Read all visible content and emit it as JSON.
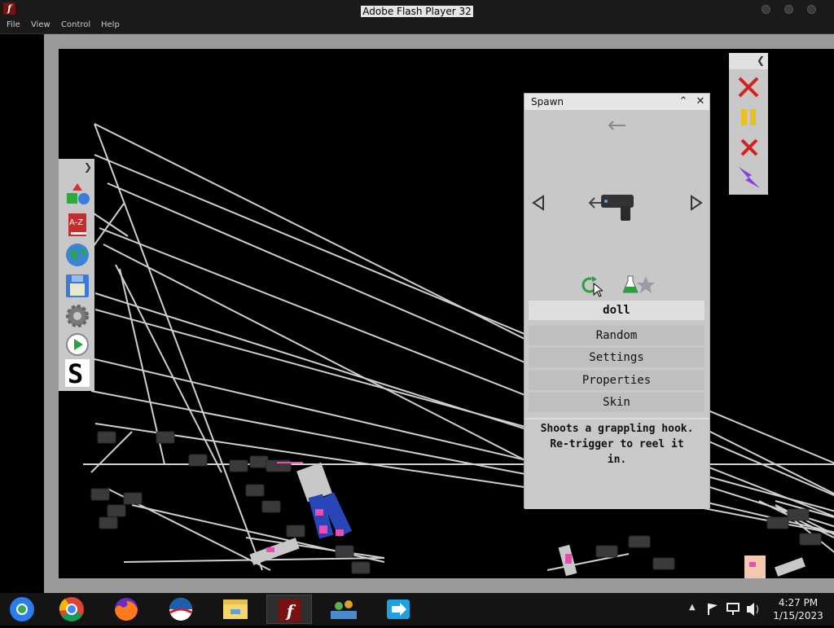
{
  "window": {
    "title": "Adobe Flash Player 32",
    "app_icon_letter": "f",
    "menu": [
      "File",
      "View",
      "Control",
      "Help"
    ]
  },
  "left_toolbar": {
    "items": [
      "shapes-icon",
      "a-z-book-icon",
      "globe-icon",
      "save-disk-icon",
      "gear-icon",
      "play-icon",
      "s-logo-icon"
    ],
    "book_label": "A-Z",
    "s_label": "S"
  },
  "right_toolbar": {
    "items": [
      "red-x-icon",
      "pause-icon",
      "red-x-small-icon",
      "lightning-icon"
    ]
  },
  "spawn_panel": {
    "title": "Spawn",
    "menu_items": [
      "doll",
      "Random",
      "Settings",
      "Properties",
      "Skin"
    ],
    "selected_item": "doll",
    "description": [
      "Shoots a grappling hook.",
      "Re-trigger to reel it",
      "in."
    ]
  },
  "taskbar": {
    "apps": [
      "chrome-alt-icon",
      "chrome-icon",
      "firefox-icon",
      "obama-logo-icon",
      "file-explorer-icon",
      "flash-player-icon",
      "network-people-icon",
      "share-arrow-icon"
    ],
    "active_app": "flash-player-icon",
    "time": "4:27 PM",
    "date": "1/15/2023"
  },
  "colors": {
    "panel_bg": "#c8c8c8",
    "stage_bg": "#000000",
    "frame": "#9a9a9a",
    "accent_pink": "#e64fb0",
    "accent_blue": "#1f3fae"
  }
}
